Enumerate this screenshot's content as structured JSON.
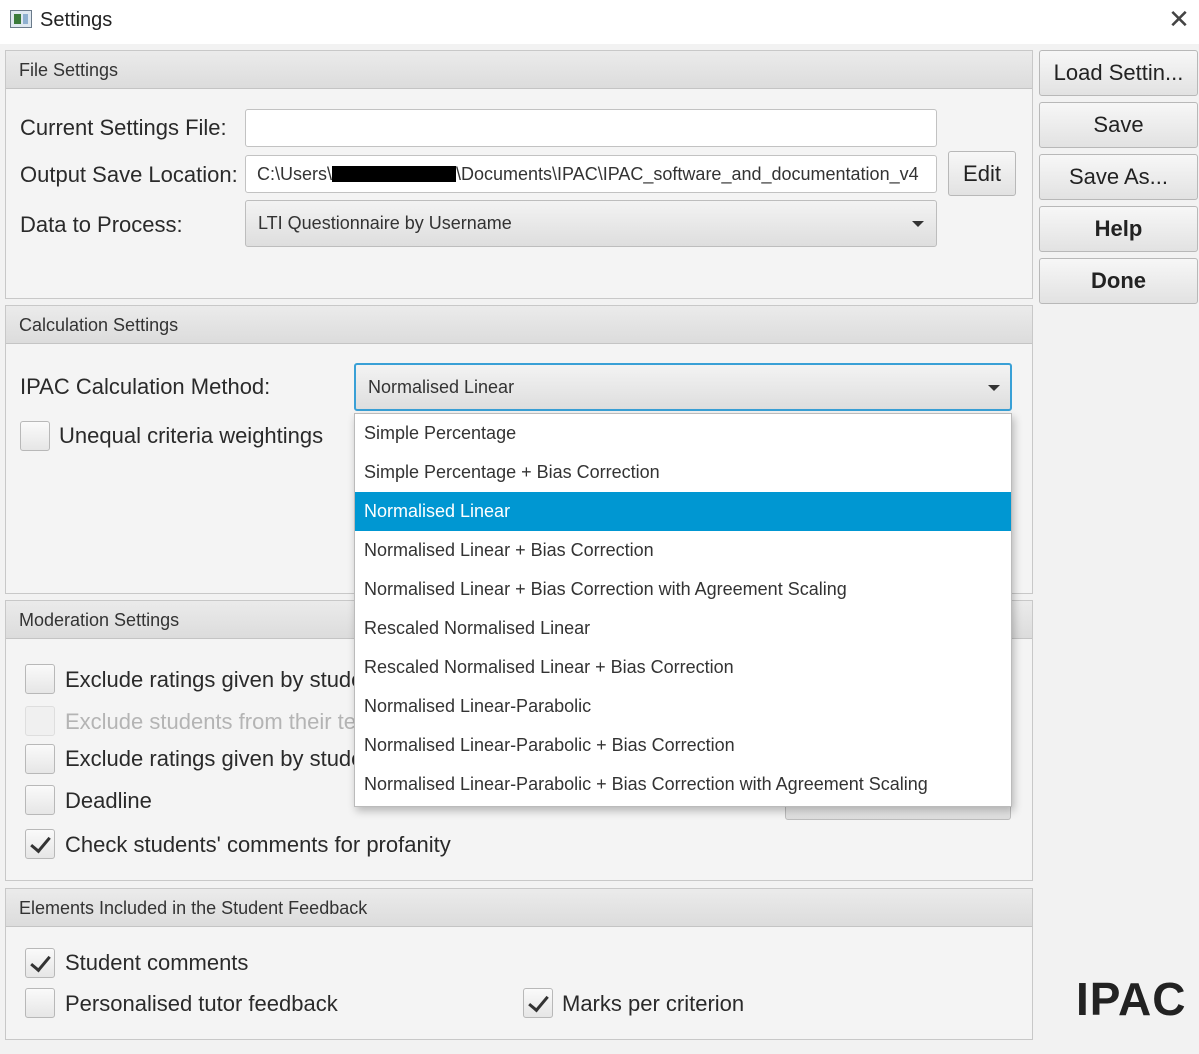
{
  "window": {
    "title": "Settings",
    "close_label": "✕"
  },
  "file_settings": {
    "header": "File Settings",
    "current_file_label": "Current Settings File:",
    "current_file_value": "",
    "output_location_label": "Output Save Location:",
    "output_location_prefix": "C:\\Users\\",
    "output_location_suffix": "\\Documents\\IPAC\\IPAC_software_and_documentation_v4",
    "edit_button": "Edit",
    "data_to_process_label": "Data to Process:",
    "data_to_process_value": "LTI Questionnaire by Username"
  },
  "side_buttons": {
    "load": "Load Settin...",
    "save": "Save",
    "save_as": "Save As...",
    "help": "Help",
    "done": "Done"
  },
  "calculation_settings": {
    "header": "Calculation Settings",
    "method_label": "IPAC Calculation Method:",
    "method_value": "Normalised Linear",
    "unequal_weightings_label": "Unequal criteria weightings",
    "unequal_weightings_checked": false
  },
  "dropdown": {
    "selected_index": 2,
    "options": [
      "Simple Percentage",
      "Simple Percentage + Bias Correction",
      "Normalised Linear",
      "Normalised Linear + Bias Correction",
      "Normalised Linear + Bias Correction with Agreement Scaling",
      "Rescaled Normalised Linear",
      "Rescaled Normalised Linear + Bias Correction",
      "Normalised Linear-Parabolic",
      "Normalised Linear-Parabolic + Bias Correction",
      "Normalised Linear-Parabolic + Bias Correction with Agreement Scaling"
    ]
  },
  "moderation_settings": {
    "header": "Moderation Settings",
    "items": [
      {
        "label": "Exclude ratings given by stude",
        "checked": false,
        "disabled": false
      },
      {
        "label": "Exclude students from their te",
        "checked": false,
        "disabled": true
      },
      {
        "label": "Exclude ratings given by stude",
        "checked": false,
        "disabled": false
      },
      {
        "label": "Deadline",
        "checked": false,
        "disabled": false
      },
      {
        "label": "Check students' comments for profanity",
        "checked": true,
        "disabled": false
      }
    ]
  },
  "feedback_elements": {
    "header": "Elements Included in the Student Feedback",
    "student_comments_label": "Student comments",
    "student_comments_checked": true,
    "tutor_feedback_label": "Personalised tutor feedback",
    "tutor_feedback_checked": false,
    "marks_per_criterion_label": "Marks per criterion",
    "marks_per_criterion_checked": true
  },
  "logo": {
    "text": "IPAC"
  },
  "colors": {
    "selection": "#0097d2",
    "focus_border": "#39a0d6"
  }
}
